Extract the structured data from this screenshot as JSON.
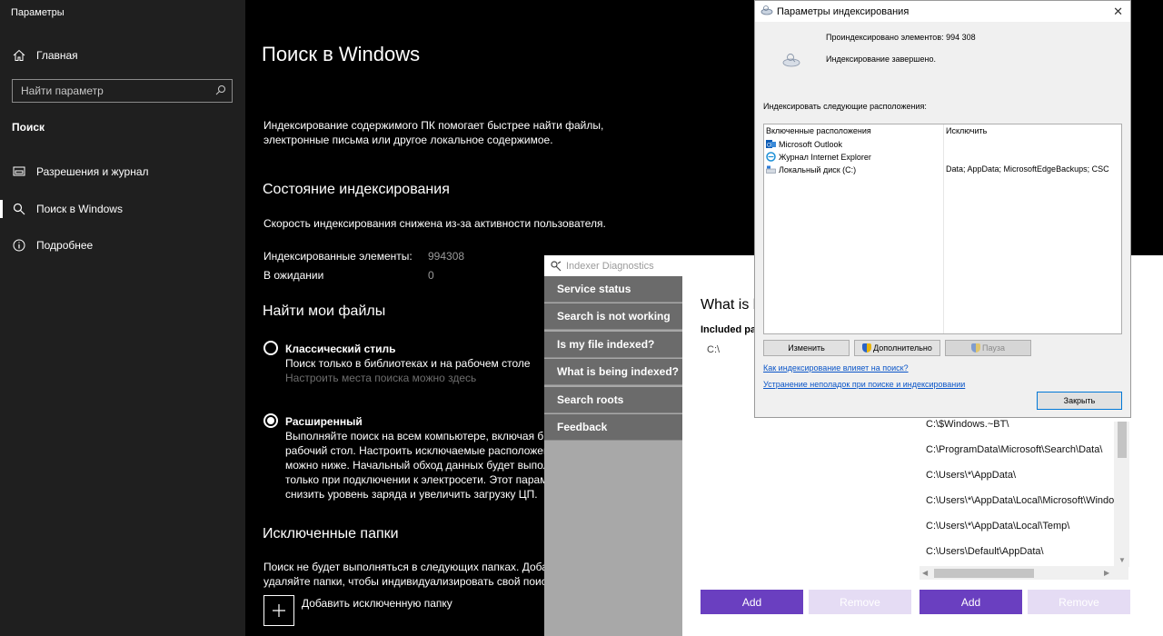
{
  "settings": {
    "window_title": "Параметры",
    "sidebar": {
      "home_label": "Главная",
      "search_placeholder": "Найти параметр",
      "section_label": "Поиск",
      "items": [
        {
          "label": "Разрешения и журнал",
          "icon": "permissions-icon"
        },
        {
          "label": "Поиск в Windows",
          "icon": "search-icon",
          "selected": true
        },
        {
          "label": "Подробнее",
          "icon": "info-icon"
        }
      ]
    },
    "main": {
      "title": "Поиск в Windows",
      "intro_line1": "Индексирование содержимого ПК помогает быстрее найти файлы,",
      "intro_line2": "электронные письма или другое локальное содержимое.",
      "indexing_status_heading": "Состояние индексирования",
      "indexing_status_text": "Скорость индексирования снижена из-за активности пользователя.",
      "indexed_label": "Индексированные элементы:",
      "indexed_value": "994308",
      "pending_label": "В ожидании",
      "pending_value": "0",
      "find_files_heading": "Найти мои файлы",
      "classic": {
        "title": "Классический стиль",
        "desc": "Поиск только в библиотеках и на рабочем столе",
        "link": "Настроить места поиска можно здесь",
        "selected": false
      },
      "enhanced": {
        "title": "Расширенный",
        "lines": [
          "Выполняйте поиск на всем компьютере, включая би",
          "рабочий стол. Настроить исключаемые расположен",
          "можно ниже. Начальный обход данных будет выпол",
          "только при подключении к электросети. Этот парам",
          "снизить уровень заряда и увеличить загрузку ЦП."
        ],
        "selected": true
      },
      "excluded_heading": "Исключенные папки",
      "excluded_line1": "Поиск не будет выполняться в следующих папках. Добав",
      "excluded_line2": "удаляйте папки, чтобы индивидуализировать свой поиск",
      "add_excluded_label": "Добавить исключенную папку"
    }
  },
  "diagnostics": {
    "window_title": "Indexer Diagnostics",
    "nav": [
      "Service status",
      "Search is not working",
      "Is my file indexed?",
      "What is being indexed?",
      "Search roots",
      "Feedback"
    ],
    "content_title": "What is b",
    "included_label": "Included pat",
    "included_item": "C:\\",
    "excluded_paths": [
      "C:\\$Windows.~BT\\",
      "C:\\ProgramData\\Microsoft\\Search\\Data\\",
      "C:\\Users\\*\\AppData\\",
      "C:\\Users\\*\\AppData\\Local\\Microsoft\\Windo",
      "C:\\Users\\*\\AppData\\Local\\Temp\\",
      "C:\\Users\\Default\\AppData\\"
    ],
    "add_label": "Add",
    "remove_label": "Remove"
  },
  "indexing_options": {
    "window_title": "Параметры индексирования",
    "indexed_count_text": "Проиндексировано элементов: 994 308",
    "status_text": "Индексирование завершено.",
    "locations_label": "Индексировать следующие расположения:",
    "col_included": "Включенные расположения",
    "col_exclude": "Исключить",
    "rows": [
      {
        "name": "Microsoft Outlook",
        "exclude": "",
        "icon": "outlook-icon"
      },
      {
        "name": "Журнал Internet Explorer",
        "exclude": "",
        "icon": "ie-icon"
      },
      {
        "name": "Локальный диск (C:)",
        "exclude": "Data; AppData; MicrosoftEdgeBackups; CSC",
        "icon": "drive-icon"
      }
    ],
    "btn_modify": "Изменить",
    "btn_advanced": "Дополнительно",
    "btn_pause": "Пауза",
    "link_affect": "Как индексирование влияет на поиск?",
    "link_troubleshoot": "Устранение неполадок при поиске и индексировании",
    "btn_close": "Закрыть"
  },
  "colors": {
    "sidebar_bg": "#1f1f1f",
    "main_bg": "#000000",
    "accent_purple": "#6a3fc0",
    "disabled_purple": "#e5dcf4",
    "link_blue": "#0a55c8"
  }
}
